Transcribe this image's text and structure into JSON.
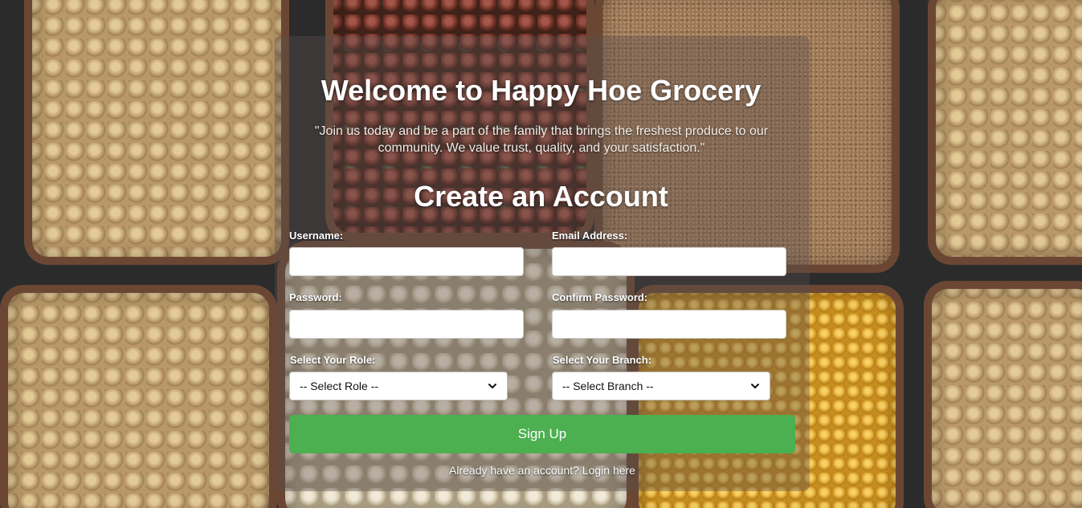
{
  "page": {
    "welcome_title": "Welcome to Happy Hoe Grocery",
    "tagline": "\"Join us today and be a part of the family that brings the freshest produce to our community. We value trust, quality, and your satisfaction.\"",
    "form_title": "Create an Account"
  },
  "form": {
    "username_label": "Username:",
    "username_value": "",
    "email_label": "Email Address:",
    "email_value": "",
    "password_label": "Password:",
    "password_value": "",
    "confirm_password_label": "Confirm Password:",
    "confirm_password_value": "",
    "role_label": "Select Your Role:",
    "role_selected": "-- Select Role --",
    "branch_label": "Select Your Branch:",
    "branch_selected": "-- Select Branch --",
    "signup_label": "Sign Up",
    "login_prompt": "Already have an account?",
    "login_link": "Login here"
  },
  "colors": {
    "signup_button": "#4caf50",
    "card_overlay": "rgba(90,80,80,0.38)",
    "text": "#ffffff"
  },
  "icons": {
    "select_arrow": "chevron-down-icon"
  }
}
